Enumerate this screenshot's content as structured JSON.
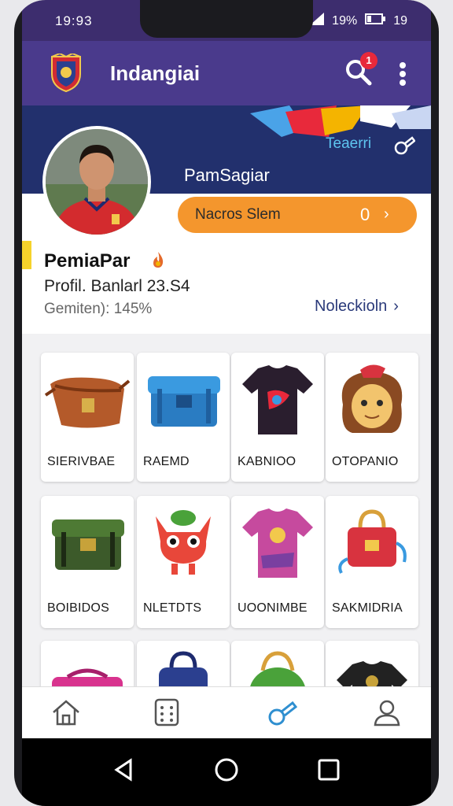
{
  "status_bar": {
    "time": "19:93",
    "battery": "19%",
    "extra": "19"
  },
  "app_bar": {
    "title": "Indangiai",
    "notification_count": "1"
  },
  "banner": {
    "tag": "Teaerri",
    "username": "PamSagiar"
  },
  "promo": {
    "label": "Nacros Slem",
    "count": "0",
    "chevron": "›"
  },
  "profile": {
    "name": "PemiaPar",
    "line": "Profil. Banlarl 23.S4",
    "stat": "Gemiten): 145%",
    "link": "Noleckioln",
    "link_chevron": "›"
  },
  "items": [
    {
      "name": "SIERIVBAE",
      "icon": "leather-bag-icon"
    },
    {
      "name": "RAEMD",
      "icon": "blue-chest-icon"
    },
    {
      "name": "KABNIOO",
      "icon": "dark-shirt-icon"
    },
    {
      "name": "OTOPANIO",
      "icon": "character-head-icon"
    },
    {
      "name": "BOIBIDOS",
      "icon": "green-chest-icon"
    },
    {
      "name": "NLETDTS",
      "icon": "creature-icon"
    },
    {
      "name": "UOONIMBE",
      "icon": "pink-shirt-icon"
    },
    {
      "name": "SAKMIDRIA",
      "icon": "red-bag-icon"
    }
  ],
  "bottom_nav": [
    "home-icon",
    "calculator-icon",
    "whistle-icon",
    "profile-icon"
  ],
  "colors": {
    "app_bar": "#4a3a8c",
    "banner": "#22306d",
    "promo": "#f4962d",
    "accent_active": "#2f8fd0"
  }
}
